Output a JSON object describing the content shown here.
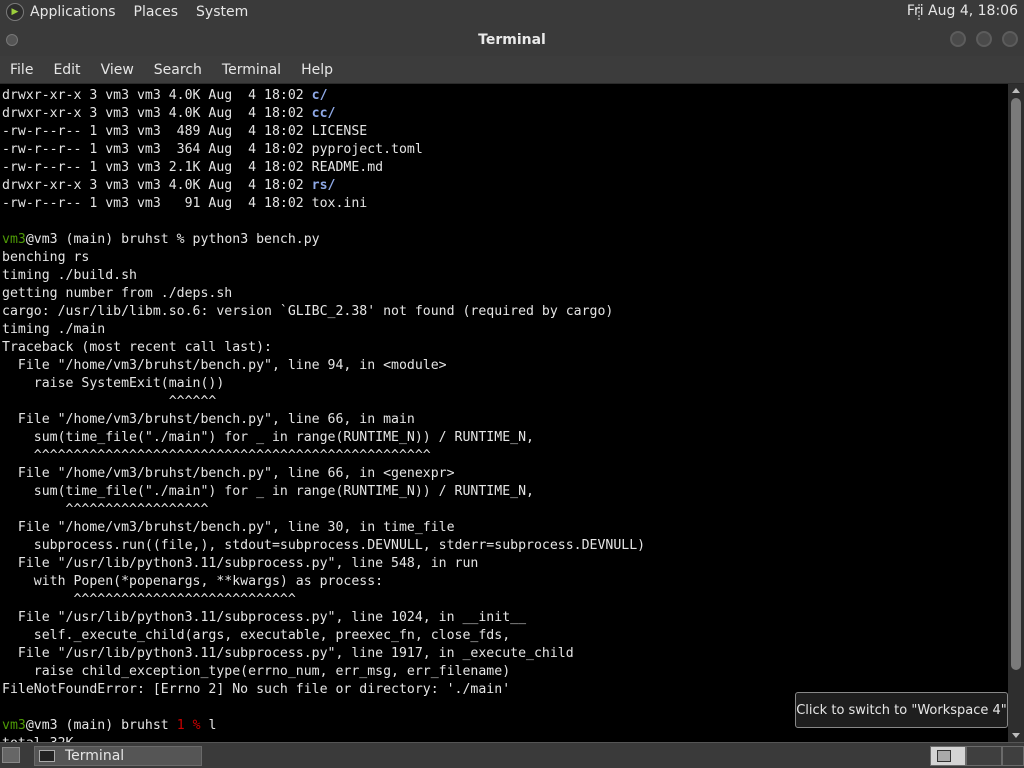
{
  "top_panel": {
    "menus": [
      "Applications",
      "Places",
      "System"
    ],
    "clock": "Fri Aug  4, 18:06"
  },
  "window": {
    "title": "Terminal"
  },
  "menubar": {
    "items": [
      "File",
      "Edit",
      "View",
      "Search",
      "Terminal",
      "Help"
    ]
  },
  "terminal": {
    "lines": [
      {
        "text": "drwxr-xr-x 3 vm3 vm3 4.0K Aug  4 18:02 ",
        "dir": "c/"
      },
      {
        "text": "drwxr-xr-x 3 vm3 vm3 4.0K Aug  4 18:02 ",
        "dir": "cc/"
      },
      {
        "text": "-rw-r--r-- 1 vm3 vm3  489 Aug  4 18:02 LICENSE"
      },
      {
        "text": "-rw-r--r-- 1 vm3 vm3  364 Aug  4 18:02 pyproject.toml"
      },
      {
        "text": "-rw-r--r-- 1 vm3 vm3 2.1K Aug  4 18:02 README.md"
      },
      {
        "text": "drwxr-xr-x 3 vm3 vm3 4.0K Aug  4 18:02 ",
        "dir": "rs/"
      },
      {
        "text": "-rw-r--r-- 1 vm3 vm3   91 Aug  4 18:02 tox.ini"
      },
      {
        "text": ""
      },
      {
        "prompt_user": "vm3",
        "text": "@vm3 (main) bruhst % python3 bench.py"
      },
      {
        "text": "benching rs"
      },
      {
        "text": "timing ./build.sh"
      },
      {
        "text": "getting number from ./deps.sh"
      },
      {
        "text": "cargo: /usr/lib/libm.so.6: version `GLIBC_2.38' not found (required by cargo)"
      },
      {
        "text": "timing ./main"
      },
      {
        "text": "Traceback (most recent call last):"
      },
      {
        "text": "  File \"/home/vm3/bruhst/bench.py\", line 94, in <module>"
      },
      {
        "text": "    raise SystemExit(main())"
      },
      {
        "text": "                     ^^^^^^"
      },
      {
        "text": "  File \"/home/vm3/bruhst/bench.py\", line 66, in main"
      },
      {
        "text": "    sum(time_file(\"./main\") for _ in range(RUNTIME_N)) / RUNTIME_N,"
      },
      {
        "text": "    ^^^^^^^^^^^^^^^^^^^^^^^^^^^^^^^^^^^^^^^^^^^^^^^^^^"
      },
      {
        "text": "  File \"/home/vm3/bruhst/bench.py\", line 66, in <genexpr>"
      },
      {
        "text": "    sum(time_file(\"./main\") for _ in range(RUNTIME_N)) / RUNTIME_N,"
      },
      {
        "text": "        ^^^^^^^^^^^^^^^^^^"
      },
      {
        "text": "  File \"/home/vm3/bruhst/bench.py\", line 30, in time_file"
      },
      {
        "text": "    subprocess.run((file,), stdout=subprocess.DEVNULL, stderr=subprocess.DEVNULL)"
      },
      {
        "text": "  File \"/usr/lib/python3.11/subprocess.py\", line 548, in run"
      },
      {
        "text": "    with Popen(*popenargs, **kwargs) as process:"
      },
      {
        "text": "         ^^^^^^^^^^^^^^^^^^^^^^^^^^^^"
      },
      {
        "text": "  File \"/usr/lib/python3.11/subprocess.py\", line 1024, in __init__"
      },
      {
        "text": "    self._execute_child(args, executable, preexec_fn, close_fds,"
      },
      {
        "text": "  File \"/usr/lib/python3.11/subprocess.py\", line 1917, in _execute_child"
      },
      {
        "text": "    raise child_exception_type(errno_num, err_msg, err_filename)"
      },
      {
        "text": "FileNotFoundError: [Errno 2] No such file or directory: './main'"
      },
      {
        "text": ""
      },
      {
        "prompt_user": "vm3",
        "text": "@vm3 (main) bruhst ",
        "err": "1 %",
        "tail": " l"
      },
      {
        "text": "total 32K"
      }
    ]
  },
  "tooltip": "Click to switch to \"Workspace 4\"",
  "taskbar": {
    "task_label": "Terminal"
  },
  "colors": {
    "prompt_user": "#4e9a06",
    "directory": "#8ea8e6",
    "error_status": "#cc0000",
    "panel_bg": "#3a3a3a"
  }
}
